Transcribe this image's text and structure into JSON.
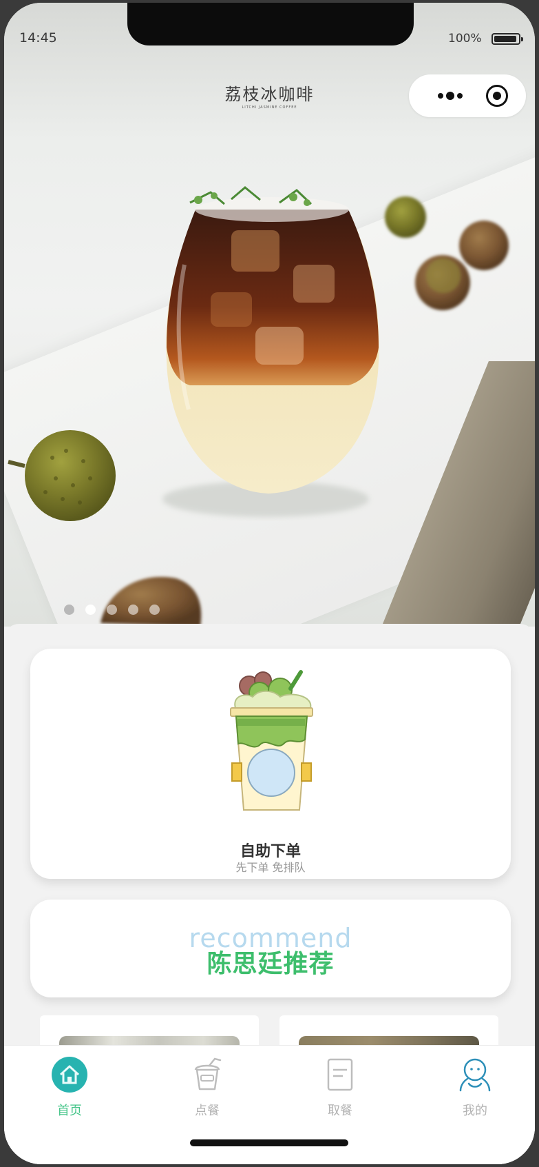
{
  "status_bar": {
    "time": "14:45",
    "battery_percent": "100%"
  },
  "header": {
    "title_cn": "荔枝冰咖啡",
    "title_en": "LITCHI JASMINE COFFEE"
  },
  "capsule": {
    "more_icon": "more-dots-icon",
    "close_icon": "target-close-icon"
  },
  "banner": {
    "slide_count": 5,
    "active_slide": 2
  },
  "order_card": {
    "title": "自助下单",
    "subtitle": "先下单 免排队",
    "icon": "bubble-tea-cup-icon"
  },
  "recommend_card": {
    "title_en": "recommend",
    "title_cn": "陈思廷推荐"
  },
  "tabbar": {
    "items": [
      {
        "label": "首页",
        "icon": "home-icon",
        "active": true
      },
      {
        "label": "点餐",
        "icon": "drink-cup-icon",
        "active": false
      },
      {
        "label": "取餐",
        "icon": "receipt-icon",
        "active": false
      },
      {
        "label": "我的",
        "icon": "user-icon",
        "active": false
      }
    ]
  },
  "colors": {
    "accent_green": "#3dbe6c",
    "tab_active": "#46c58a",
    "home_icon_teal": "#27b3b0",
    "recommend_en": "#b6d9ee"
  }
}
